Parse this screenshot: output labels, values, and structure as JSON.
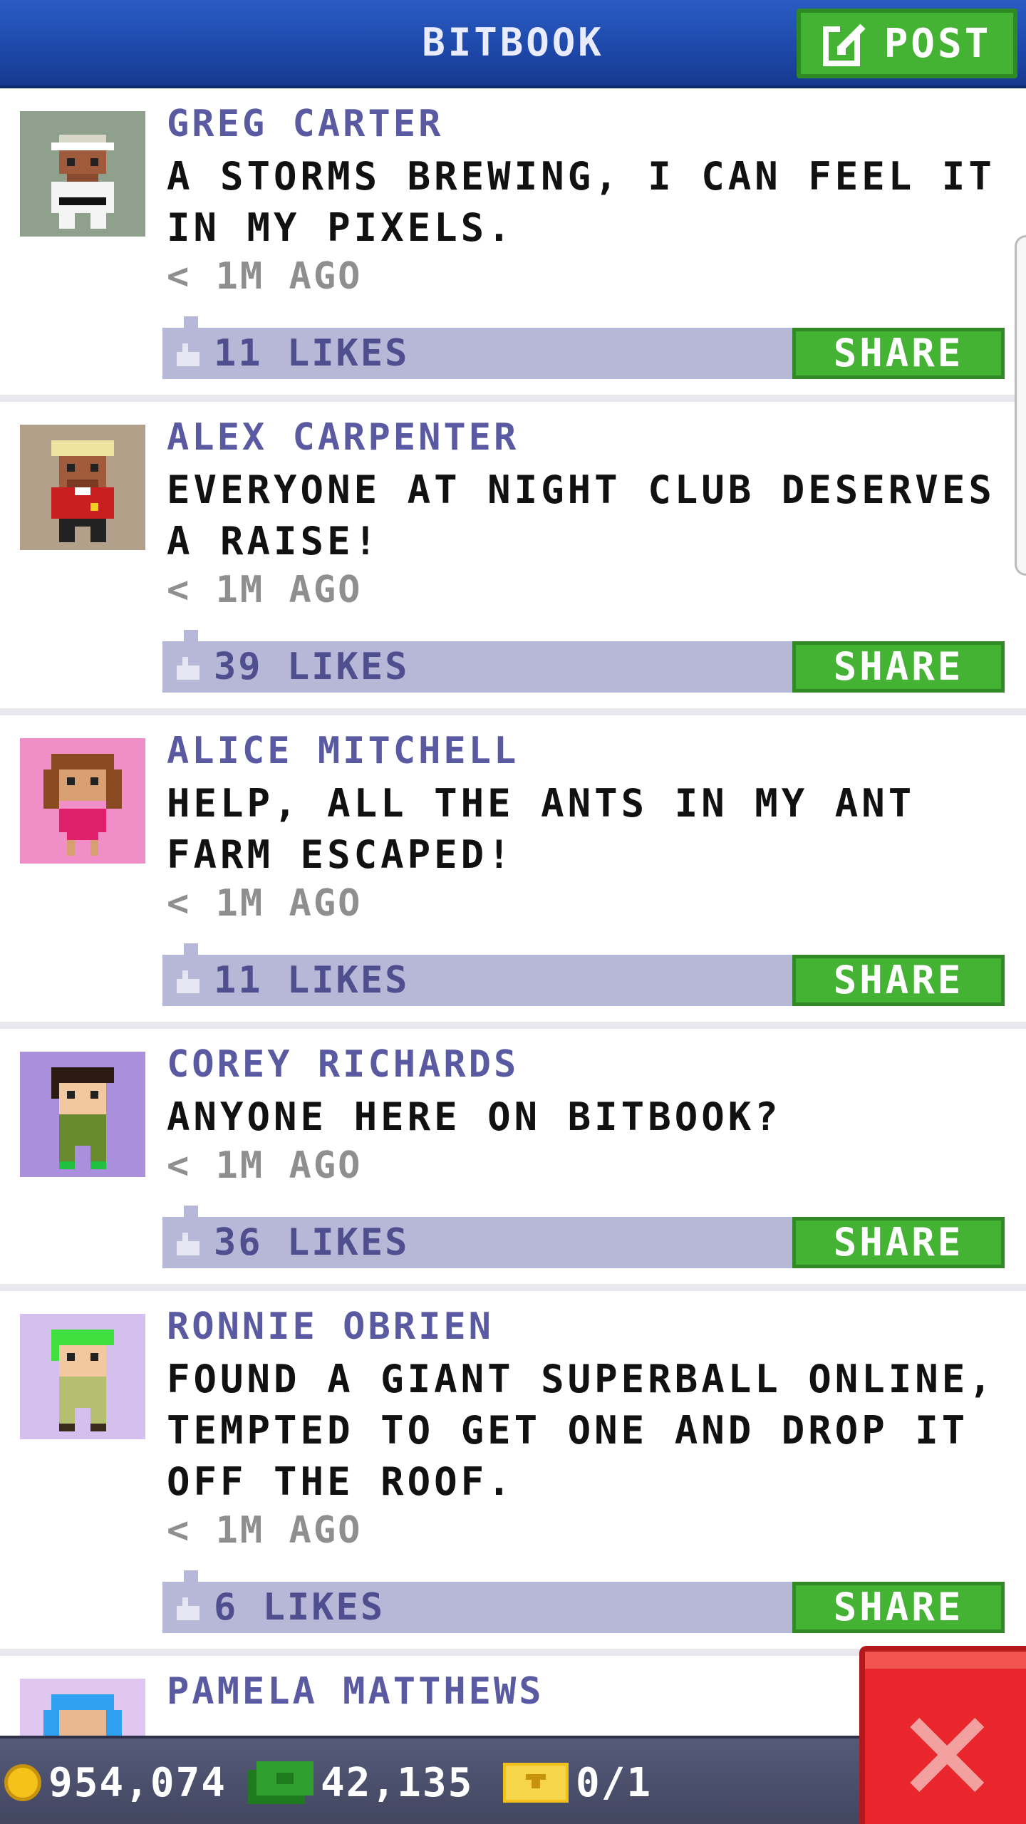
{
  "header": {
    "title": "BITBOOK",
    "post_label": "POST"
  },
  "posts": [
    {
      "name": "GREG CARTER",
      "message": "A STORMS BREWING, I CAN FEEL IT IN MY PIXELS.",
      "time": "< 1M AGO",
      "likes": "11 LIKES",
      "share_label": "SHARE",
      "avatar_bg": "#8fa08c"
    },
    {
      "name": "ALEX CARPENTER",
      "message": "EVERYONE AT NIGHT CLUB DESERVES A RAISE!",
      "time": "< 1M AGO",
      "likes": "39 LIKES",
      "share_label": "SHARE",
      "avatar_bg": "#b3a08a"
    },
    {
      "name": "ALICE MITCHELL",
      "message": "HELP, ALL THE ANTS IN MY ANT FARM ESCAPED!",
      "time": "< 1M AGO",
      "likes": "11 LIKES",
      "share_label": "SHARE",
      "avatar_bg": "#f08ec8"
    },
    {
      "name": "COREY RICHARDS",
      "message": "ANYONE HERE ON BITBOOK?",
      "time": "< 1M AGO",
      "likes": "36 LIKES",
      "share_label": "SHARE",
      "avatar_bg": "#a98fdc"
    },
    {
      "name": "RONNIE OBRIEN",
      "message": "FOUND A GIANT SUPERBALL ONLINE, TEMPTED TO GET ONE AND DROP IT OFF THE ROOF.",
      "time": "< 1M AGO",
      "likes": "6 LIKES",
      "share_label": "SHARE",
      "avatar_bg": "#d4bfef"
    },
    {
      "name": "PAMELA MATTHEWS",
      "avatar_bg": "#e0c7f2"
    }
  ],
  "footer": {
    "coins": "954,074",
    "bux": "42,135",
    "tickets": "0/1"
  },
  "colors": {
    "accent_blue": "#1d47a8",
    "share_green": "#44b233",
    "close_red": "#e8262b",
    "like_bar": "#b7b7d8"
  }
}
